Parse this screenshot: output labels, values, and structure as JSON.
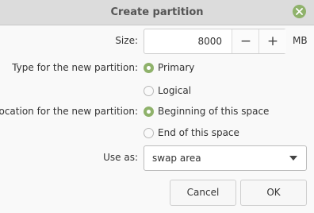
{
  "window": {
    "title": "Create partition",
    "close_icon": "close-icon"
  },
  "size": {
    "label": "Size:",
    "value": "8000",
    "decrement": "−",
    "increment": "+",
    "unit": "MB"
  },
  "type": {
    "label": "Type for the new partition:",
    "options": [
      {
        "label": "Primary",
        "checked": true
      },
      {
        "label": "Logical",
        "checked": false
      }
    ]
  },
  "location": {
    "label": "Location for the new partition:",
    "options": [
      {
        "label": "Beginning of this space",
        "checked": true
      },
      {
        "label": "End of this space",
        "checked": false
      }
    ]
  },
  "use_as": {
    "label": "Use as:",
    "value": "swap area"
  },
  "buttons": {
    "cancel": "Cancel",
    "ok": "OK"
  },
  "colors": {
    "accent": "#8fb26b",
    "titlebar": "#dcdcdc",
    "background": "#f9f9f9"
  }
}
